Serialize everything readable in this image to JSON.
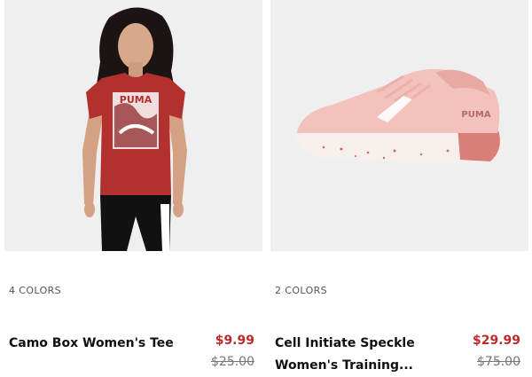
{
  "products": [
    {
      "colors": "4 COLORS",
      "name": "Camo Box Women's Tee",
      "price": "$9.99",
      "original_price": "$25.00",
      "graphic_text": "PUMA"
    },
    {
      "colors": "2 COLORS",
      "name_line1": "Cell Initiate Speckle",
      "name_line2": "Women's Training...",
      "price": "$29.99",
      "original_price": "$75.00",
      "shoe_text": "PUMA"
    }
  ],
  "colors": {
    "sale_price": "#ba2b2b",
    "tee": "#b2302d",
    "shoe": "#f3c2bd"
  }
}
